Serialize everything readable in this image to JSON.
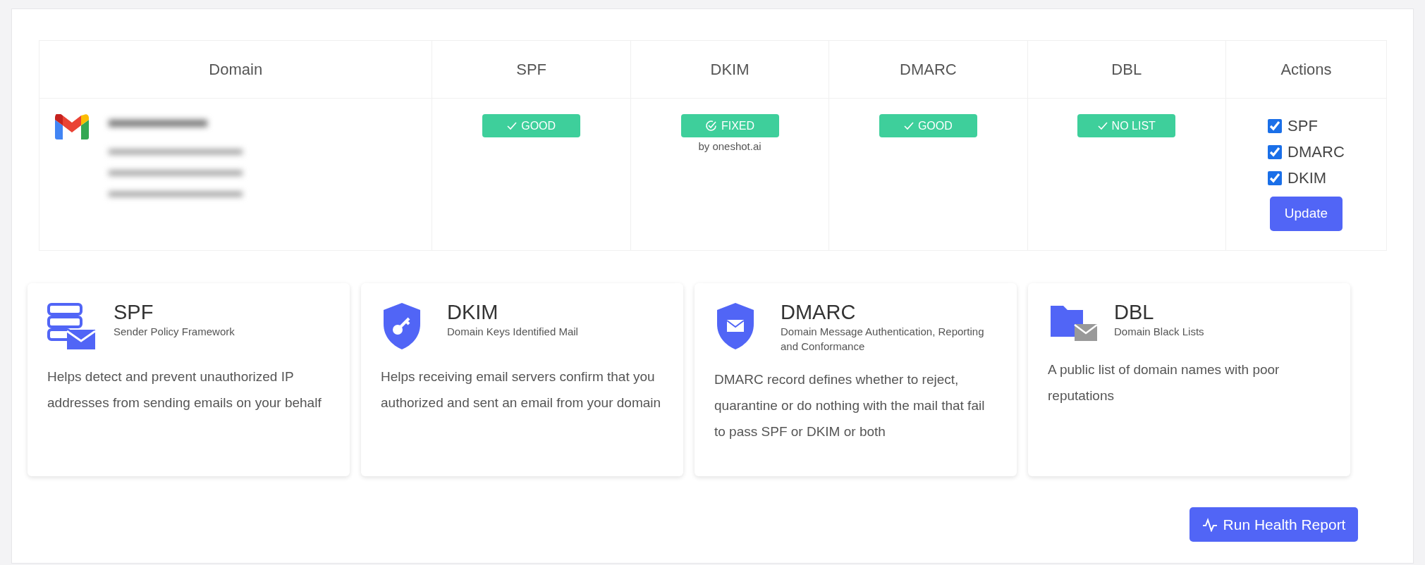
{
  "table": {
    "columns": [
      "Domain",
      "SPF",
      "DKIM",
      "DMARC",
      "DBL",
      "Actions"
    ],
    "row": {
      "domain": {
        "kind": "gmail"
      },
      "statuses": [
        {
          "kind": "good",
          "label": "GOOD"
        },
        {
          "kind": "fixed",
          "label": "FIXED",
          "note": "by oneshot.ai"
        },
        {
          "kind": "good",
          "label": "GOOD"
        },
        {
          "kind": "good",
          "label": "NO LIST"
        }
      ],
      "actions": [
        {
          "label": "SPF",
          "checked": true
        },
        {
          "label": "DMARC",
          "checked": true
        },
        {
          "label": "DKIM",
          "checked": true
        }
      ],
      "button": "Update"
    }
  },
  "cards": [
    {
      "kind": "server",
      "title": "SPF",
      "subtitle": "Sender Policy Framework",
      "text": "Helps detect and prevent unauthorized IP addresses from sending emails on your behalf"
    },
    {
      "kind": "key",
      "title": "DKIM",
      "subtitle": "Domain Keys Identified Mail",
      "text": "Helps receiving email servers confirm that you authorized and sent an email from your domain"
    },
    {
      "kind": "mail",
      "title": "DMARC",
      "subtitle": "Domain Message Authentication, Reporting and Conformance",
      "text": "DMARC record defines whether to reject, quarantine or do nothing with the mail that fail to pass SPF or DKIM or both"
    },
    {
      "kind": "folder",
      "title": "DBL",
      "subtitle": "Domain Black Lists",
      "text": "A public list of domain names with poor reputations"
    }
  ],
  "report_button": "Run Health Report"
}
